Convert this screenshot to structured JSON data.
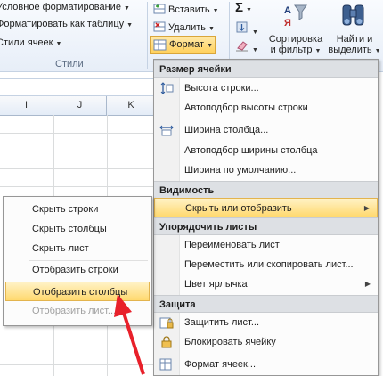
{
  "ribbon": {
    "styles_group": {
      "conditional_formatting": "Условное форматирование",
      "format_as_table": "Форматировать как таблицу",
      "cell_styles": "Стили ячеек",
      "group_label": "Стили"
    },
    "cells_group": {
      "insert": "Вставить",
      "delete": "Удалить",
      "format": "Формат"
    },
    "editing_group": {
      "sigma": "Σ",
      "sort_filter_line1": "Сортировка",
      "sort_filter_line2": "и фильтр",
      "find_select_line1": "Найти и",
      "find_select_line2": "выделить"
    }
  },
  "sheet": {
    "columns": [
      "I",
      "J",
      "K"
    ]
  },
  "format_menu": {
    "sections": {
      "cell_size": "Размер ячейки",
      "visibility": "Видимость",
      "organize_sheets": "Упорядочить листы",
      "protection": "Защита"
    },
    "items": {
      "row_height": "Высота строки...",
      "autofit_row_height": "Автоподбор высоты строки",
      "column_width": "Ширина столбца...",
      "autofit_column_width": "Автоподбор ширины столбца",
      "default_width": "Ширина по умолчанию...",
      "hide_unhide": "Скрыть или отобразить",
      "rename_sheet": "Переименовать лист",
      "move_copy_sheet": "Переместить или скопировать лист...",
      "tab_color": "Цвет ярлычка",
      "protect_sheet": "Защитить лист...",
      "lock_cell": "Блокировать ячейку",
      "format_cells": "Формат ячеек..."
    }
  },
  "hide_submenu": {
    "items": [
      "Скрыть строки",
      "Скрыть столбцы",
      "Скрыть лист",
      "Отобразить строки",
      "Отобразить столбцы",
      "Отобразить лист..."
    ],
    "highlighted_index": 4,
    "disabled_index": 5
  },
  "colors": {
    "highlight": "#ffd96f",
    "arrow": "#e8202a",
    "ribbon_bg": "#e7eef8"
  }
}
